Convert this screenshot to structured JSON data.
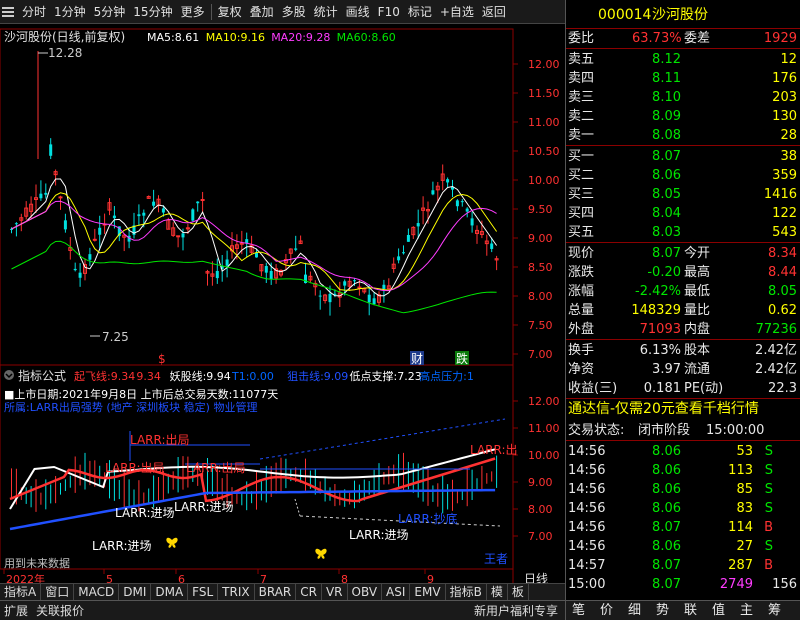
{
  "toolbar": {
    "items": [
      "分时",
      "1分钟",
      "5分钟",
      "15分钟",
      "更多",
      "复权",
      "叠加",
      "多股",
      "统计",
      "画线",
      "F10",
      "标记",
      "+自选",
      "返回"
    ]
  },
  "main_chart": {
    "title": "沙河股份(日线,前复权)",
    "ma": [
      {
        "label": "MA5:",
        "value": "8.61",
        "color": "#ffffff"
      },
      {
        "label": "MA10:",
        "value": "9.16",
        "color": "#ffff00"
      },
      {
        "label": "MA20:",
        "value": "9.28",
        "color": "#ff3cff"
      },
      {
        "label": "MA60:",
        "value": "8.60",
        "color": "#00e600"
      }
    ],
    "high_label": "12.28",
    "low_label": "7.25",
    "price_ticks": [
      "12.00",
      "11.50",
      "11.00",
      "10.50",
      "10.00",
      "9.50",
      "9.00",
      "8.50",
      "8.00",
      "7.50",
      "7.00"
    ],
    "event_markers": [
      "$",
      "财",
      "跌"
    ]
  },
  "indicator": {
    "header_name": "指标公式",
    "header_items": [
      {
        "label": "起飞线:",
        "value": "9.34",
        "color": "#ff3232"
      },
      {
        "label": "",
        "value": "9.34",
        "color": "#ff3232"
      },
      {
        "label": "妖股线:",
        "value": "9.94",
        "color": "#ffffff"
      },
      {
        "label": "T1:",
        "value": "0.00",
        "color": "#0066ff"
      },
      {
        "label": "狙击线:",
        "value": "9.09",
        "color": "#2050ff"
      },
      {
        "label": "低点支撑:",
        "value": "7.23",
        "color": "#ffffff"
      },
      {
        "label": "高点压力:",
        "value": "1",
        "color": "#0066ff"
      }
    ],
    "info_line": "■上市日期:2021年9月8日 上市后总交易天数:11077天",
    "desc_line": "所属:LARR出局强势 (地产 深圳板块 稳定) 物业管理",
    "labels": [
      "LARR:出局",
      "LARR:出局",
      "LARR:出局",
      "LARR:进场",
      "LARR:进场",
      "LARR:进场",
      "LARR:进场",
      "LARR:抄底",
      "LARR:出",
      "王者"
    ],
    "future_note": "用到未来数据",
    "ticks": [
      "12.00",
      "11.00",
      "10.00",
      "9.00",
      "8.00",
      "7.00"
    ],
    "timeline": [
      "2022年",
      "5",
      "6",
      "7",
      "8",
      "9"
    ],
    "period": "日线"
  },
  "tabs": [
    "指标A",
    "窗口",
    "MACD",
    "DMI",
    "DMA",
    "FSL",
    "TRIX",
    "BRAR",
    "CR",
    "VR",
    "OBV",
    "ASI",
    "EMV",
    "指标B",
    "模",
    "板"
  ],
  "status": {
    "left": [
      "扩展",
      "关联报价"
    ],
    "right": "新用户福利专享",
    "right_tabs": [
      "笔",
      "价",
      "细",
      "势",
      "联",
      "值",
      "主",
      "筹"
    ]
  },
  "quote": {
    "code": "000014",
    "name": "沙河股份",
    "weibi_label": "委比",
    "weibi": "63.73%",
    "weicha_label": "委差",
    "weicha": "1929",
    "asks": [
      {
        "label": "卖五",
        "price": "8.12",
        "vol": "12"
      },
      {
        "label": "卖四",
        "price": "8.11",
        "vol": "176"
      },
      {
        "label": "卖三",
        "price": "8.10",
        "vol": "203"
      },
      {
        "label": "卖二",
        "price": "8.09",
        "vol": "130"
      },
      {
        "label": "卖一",
        "price": "8.08",
        "vol": "28"
      }
    ],
    "bids": [
      {
        "label": "买一",
        "price": "8.07",
        "vol": "38"
      },
      {
        "label": "买二",
        "price": "8.06",
        "vol": "359"
      },
      {
        "label": "买三",
        "price": "8.05",
        "vol": "1416"
      },
      {
        "label": "买四",
        "price": "8.04",
        "vol": "122"
      },
      {
        "label": "买五",
        "price": "8.03",
        "vol": "543"
      }
    ],
    "stats": [
      {
        "l1": "现价",
        "v1": "8.07",
        "c1": "green",
        "l2": "今开",
        "v2": "8.34",
        "c2": "red"
      },
      {
        "l1": "涨跌",
        "v1": "-0.20",
        "c1": "green",
        "l2": "最高",
        "v2": "8.44",
        "c2": "red"
      },
      {
        "l1": "涨幅",
        "v1": "-2.42%",
        "c1": "green",
        "l2": "最低",
        "v2": "8.05",
        "c2": "green"
      },
      {
        "l1": "总量",
        "v1": "148329",
        "c1": "yellow",
        "l2": "量比",
        "v2": "0.62",
        "c2": "yellow"
      },
      {
        "l1": "外盘",
        "v1": "71093",
        "c1": "red",
        "l2": "内盘",
        "v2": "77236",
        "c2": "green"
      }
    ],
    "stats2": [
      {
        "l1": "换手",
        "v1": "6.13%",
        "l2": "股本",
        "v2": "2.42亿"
      },
      {
        "l1": "净资",
        "v1": "3.97",
        "l2": "流通",
        "v2": "2.42亿"
      },
      {
        "l1": "收益(三)",
        "v1": "0.181",
        "l2": "PE(动)",
        "v2": "22.3"
      }
    ],
    "promo": "通达信-仅需20元查看千档行情",
    "trade_status_label": "交易状态:",
    "trade_status": "闭市阶段",
    "trade_time": "15:00:00",
    "ticks": [
      {
        "time": "14:56",
        "price": "8.06",
        "vol": "53",
        "side": "S"
      },
      {
        "time": "14:56",
        "price": "8.06",
        "vol": "113",
        "side": "S"
      },
      {
        "time": "14:56",
        "price": "8.06",
        "vol": "85",
        "side": "S"
      },
      {
        "time": "14:56",
        "price": "8.06",
        "vol": "83",
        "side": "S"
      },
      {
        "time": "14:56",
        "price": "8.07",
        "vol": "114",
        "side": "B"
      },
      {
        "time": "14:56",
        "price": "8.06",
        "vol": "27",
        "side": "S"
      },
      {
        "time": "14:57",
        "price": "8.07",
        "vol": "287",
        "side": "B"
      },
      {
        "time": "15:00",
        "price": "8.07",
        "vol": "2749",
        "side": "",
        "extra": "156"
      }
    ]
  }
}
